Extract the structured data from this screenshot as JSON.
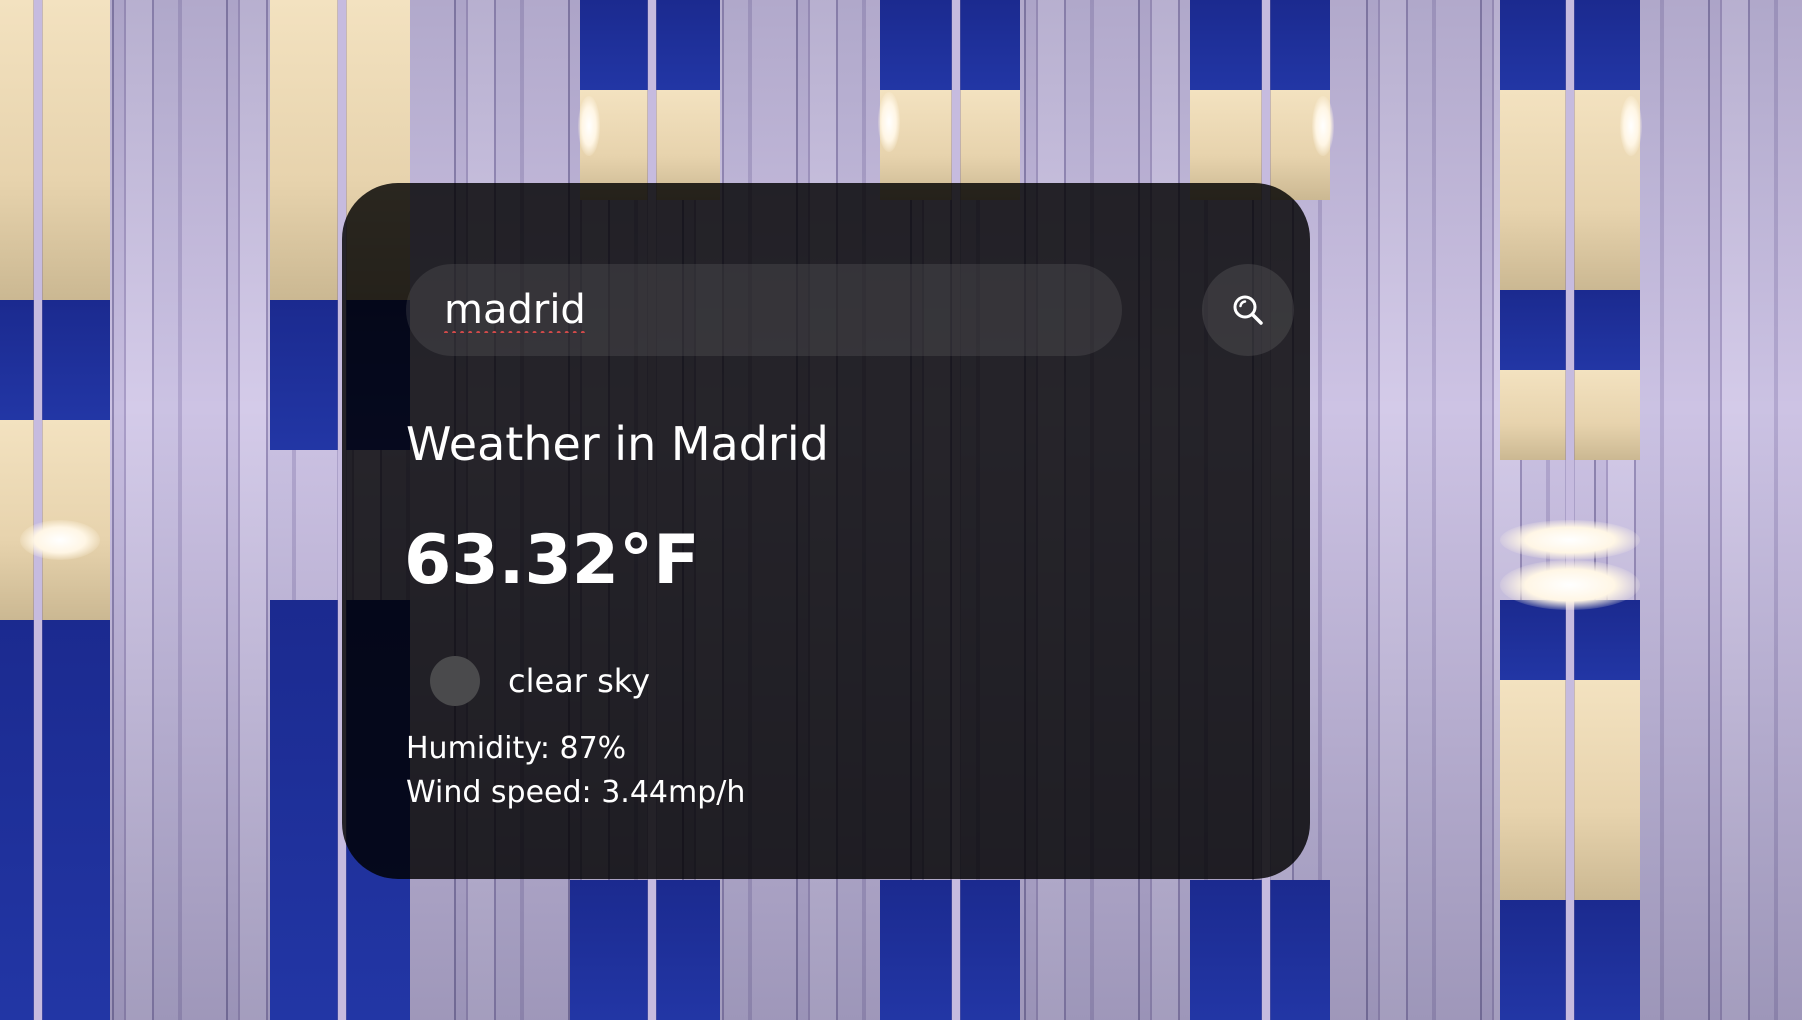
{
  "search": {
    "value": "madrid",
    "button_icon": "search-icon"
  },
  "weather": {
    "title": "Weather in Madrid",
    "temperature": "63.32°F",
    "description": "clear sky",
    "icon": "weather-condition-icon",
    "humidity": "Humidity: 87%",
    "wind": "Wind speed: 3.44mp/h"
  },
  "colors": {
    "card_background": "#000000",
    "text": "#ffffff",
    "spellcheck_underline": "#d24a4a"
  }
}
